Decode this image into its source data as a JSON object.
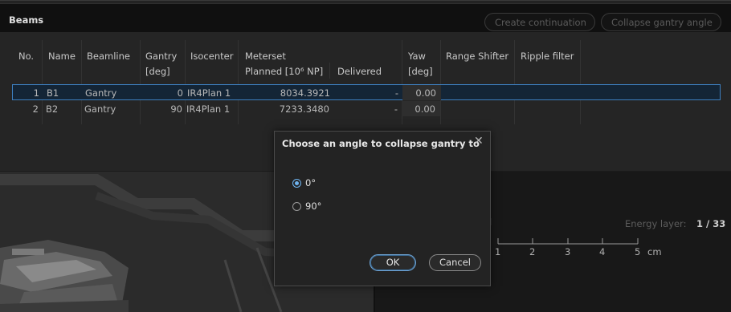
{
  "beams": {
    "title": "Beams",
    "create_continuation": "Create continuation",
    "collapse_gantry": "Collapse gantry angle",
    "columns": {
      "no": "No.",
      "name": "Name",
      "beamline": "Beamline",
      "gantry": "Gantry",
      "gantry_unit": "[deg]",
      "isocenter": "Isocenter",
      "meterset": "Meterset",
      "planned": "Planned [10⁶ NP]",
      "delivered": "Delivered",
      "yaw": "Yaw",
      "yaw_unit": "[deg]",
      "range_shifter": "Range Shifter",
      "ripple_filter": "Ripple filter"
    },
    "rows": [
      {
        "no": "1",
        "name": "B1",
        "beamline": "Gantry",
        "gantry": "0",
        "isocenter": "IR4Plan 1",
        "planned": "8034.3921",
        "delivered": "-",
        "yaw": "0.00"
      },
      {
        "no": "2",
        "name": "B2",
        "beamline": "Gantry",
        "gantry": "90",
        "isocenter": "IR4Plan 1",
        "planned": "7233.3480",
        "delivered": "-",
        "yaw": "0.00"
      }
    ]
  },
  "energy": {
    "label": "Energy layer:",
    "value": "1 / 33"
  },
  "ruler": {
    "ticks": [
      "1",
      "2",
      "3",
      "4",
      "5"
    ],
    "unit": "cm"
  },
  "dialog": {
    "title": "Choose an angle to collapse gantry to",
    "options": [
      {
        "label": "0°",
        "selected": true
      },
      {
        "label": "90°",
        "selected": false
      }
    ],
    "ok": "OK",
    "cancel": "Cancel"
  },
  "colors": {
    "accent": "#6fb4f0",
    "selected_row_bg": "#142536",
    "selected_row_border": "#3e7fbf"
  }
}
